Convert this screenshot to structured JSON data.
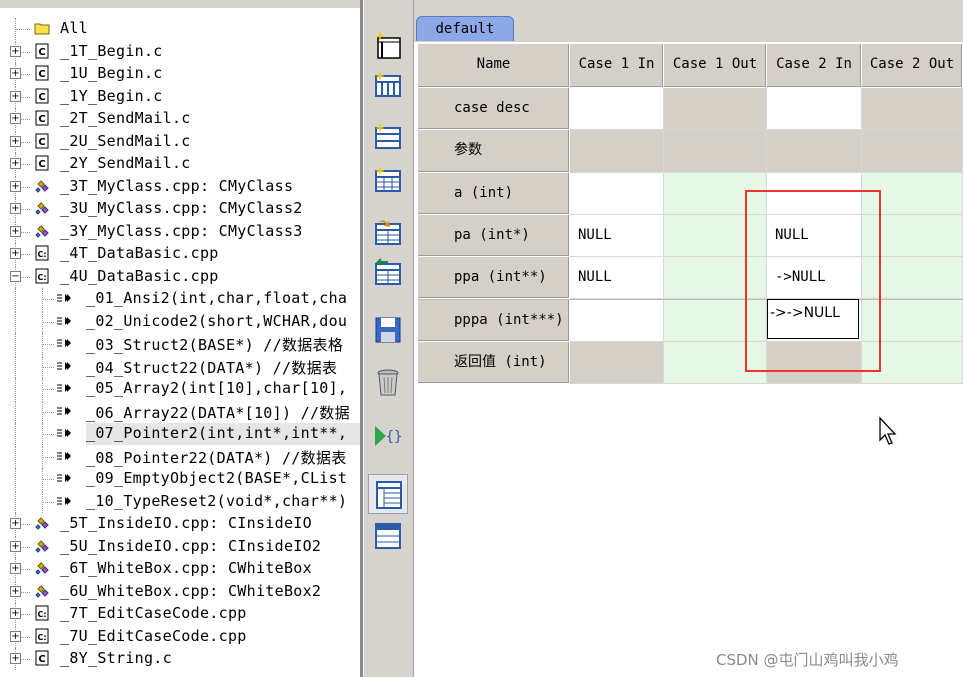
{
  "tree": {
    "items": [
      {
        "label": "All",
        "icon": "folder-icon",
        "expander": "",
        "depth": 0
      },
      {
        "label": "_1T_Begin.c",
        "icon": "c-file-icon",
        "expander": "+",
        "depth": 0
      },
      {
        "label": "_1U_Begin.c",
        "icon": "c-file-icon",
        "expander": "+",
        "depth": 0
      },
      {
        "label": "_1Y_Begin.c",
        "icon": "c-file-icon",
        "expander": "+",
        "depth": 0
      },
      {
        "label": "_2T_SendMail.c",
        "icon": "c-file-icon",
        "expander": "+",
        "depth": 0
      },
      {
        "label": "_2U_SendMail.c",
        "icon": "c-file-icon",
        "expander": "+",
        "depth": 0
      },
      {
        "label": "_2Y_SendMail.c",
        "icon": "c-file-icon",
        "expander": "+",
        "depth": 0
      },
      {
        "label": "_3T_MyClass.cpp: CMyClass",
        "icon": "class-icon",
        "expander": "+",
        "depth": 0
      },
      {
        "label": "_3U_MyClass.cpp: CMyClass2",
        "icon": "class-icon",
        "expander": "+",
        "depth": 0
      },
      {
        "label": "_3Y_MyClass.cpp: CMyClass3",
        "icon": "class-icon",
        "expander": "+",
        "depth": 0
      },
      {
        "label": "_4T_DataBasic.cpp",
        "icon": "cpp-file-icon",
        "expander": "+",
        "depth": 0
      },
      {
        "label": "_4U_DataBasic.cpp",
        "icon": "cpp-file-icon",
        "expander": "−",
        "depth": 0
      },
      {
        "label": "_01_Ansi2(int,char,float,cha",
        "icon": "function-icon",
        "expander": "",
        "depth": 1
      },
      {
        "label": "_02_Unicode2(short,WCHAR,dou",
        "icon": "function-icon",
        "expander": "",
        "depth": 1
      },
      {
        "label": "_03_Struct2(BASE*) //数据表格",
        "icon": "function-icon",
        "expander": "",
        "depth": 1
      },
      {
        "label": "_04_Struct22(DATA*) //数据表",
        "icon": "function-icon",
        "expander": "",
        "depth": 1
      },
      {
        "label": "_05_Array2(int[10],char[10],",
        "icon": "function-icon",
        "expander": "",
        "depth": 1
      },
      {
        "label": "_06_Array22(DATA*[10]) //数据",
        "icon": "function-icon",
        "expander": "",
        "depth": 1
      },
      {
        "label": "_07_Pointer2(int,int*,int**,",
        "icon": "function-icon",
        "expander": "",
        "depth": 1,
        "selected": true
      },
      {
        "label": "_08_Pointer22(DATA*) //数据表",
        "icon": "function-icon",
        "expander": "",
        "depth": 1
      },
      {
        "label": "_09_EmptyObject2(BASE*,CList",
        "icon": "function-icon",
        "expander": "",
        "depth": 1
      },
      {
        "label": "_10_TypeReset2(void*,char**)",
        "icon": "function-icon",
        "expander": "",
        "depth": 1
      },
      {
        "label": "_5T_InsideIO.cpp: CInsideIO",
        "icon": "class-icon",
        "expander": "+",
        "depth": 0
      },
      {
        "label": "_5U_InsideIO.cpp: CInsideIO2",
        "icon": "class-icon",
        "expander": "+",
        "depth": 0
      },
      {
        "label": "_6T_WhiteBox.cpp: CWhiteBox",
        "icon": "class-icon",
        "expander": "+",
        "depth": 0
      },
      {
        "label": "_6U_WhiteBox.cpp: CWhiteBox2",
        "icon": "class-icon",
        "expander": "+",
        "depth": 0
      },
      {
        "label": "_7T_EditCaseCode.cpp",
        "icon": "cpp-file-icon",
        "expander": "+",
        "depth": 0
      },
      {
        "label": "_7U_EditCaseCode.cpp",
        "icon": "cpp-file-icon",
        "expander": "+",
        "depth": 0
      },
      {
        "label": "_8Y_String.c",
        "icon": "c-file-icon",
        "expander": "+",
        "depth": 0
      }
    ]
  },
  "toolbar": {
    "buttons": [
      {
        "name": "new-window-icon"
      },
      {
        "name": "add-columns-icon"
      },
      {
        "name": "add-row-icon"
      },
      {
        "name": "add-table-icon"
      },
      {
        "name": "import-table-icon"
      },
      {
        "name": "export-table-icon"
      },
      {
        "name": "save-disk-icon"
      },
      {
        "name": "trash-can-icon"
      },
      {
        "name": "run-code-icon"
      },
      {
        "name": "grid-view-icon"
      },
      {
        "name": "table-view-icon"
      }
    ]
  },
  "grid": {
    "tab_label": "default",
    "columns": [
      "Name",
      "Case 1 In",
      "Case 1 Out",
      "Case 2 In",
      "Case 2 Out"
    ],
    "rows": [
      {
        "name": "case desc",
        "cells": [
          "",
          "",
          "",
          ""
        ],
        "kinds": [
          "w",
          "g",
          "w",
          "g"
        ]
      },
      {
        "name": "参数",
        "cells": [
          "",
          "",
          "",
          ""
        ],
        "kinds": [
          "g",
          "g",
          "g",
          "g"
        ]
      },
      {
        "name": "a (int)",
        "cells": [
          "",
          "",
          "",
          ""
        ],
        "kinds": [
          "w",
          "lg",
          "w",
          "lg"
        ]
      },
      {
        "name": "pa (int*)",
        "cells": [
          "NULL",
          "",
          "NULL",
          ""
        ],
        "kinds": [
          "w",
          "lg",
          "w",
          "lg"
        ]
      },
      {
        "name": "ppa (int**)",
        "cells": [
          "NULL",
          "",
          "->NULL",
          ""
        ],
        "kinds": [
          "w",
          "lg",
          "w",
          "lg"
        ]
      },
      {
        "name": "pppa (int***)",
        "cells": [
          "",
          "",
          "",
          ""
        ],
        "kinds": [
          "w",
          "lg",
          "w",
          "lg"
        ]
      },
      {
        "name": "返回值 (int)",
        "cells": [
          "",
          "",
          "",
          ""
        ],
        "kinds": [
          "g",
          "lg",
          "g",
          "lg"
        ]
      }
    ],
    "edit_value": "->->NULL"
  },
  "colors": {
    "highlight_border": "#e33333",
    "tab_fill": "#8aa9e6",
    "out_cell_fill": "#e6f7e6"
  },
  "watermark": "CSDN @屯门山鸡叫我小鸡"
}
